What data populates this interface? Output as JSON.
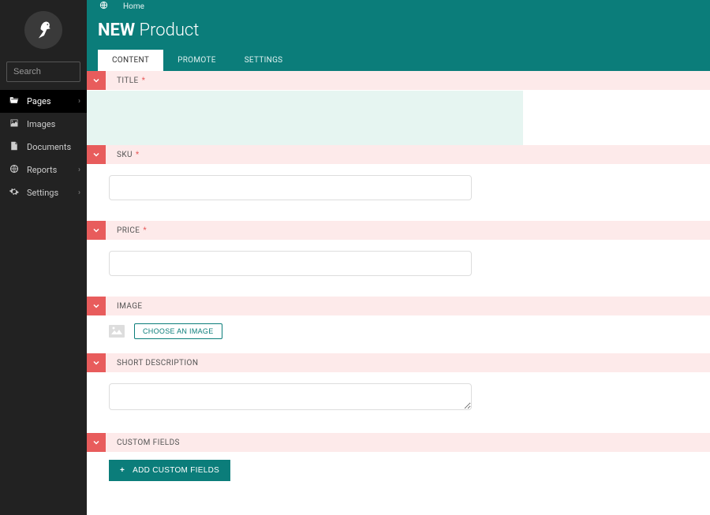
{
  "sidebar": {
    "search_placeholder": "Search",
    "items": [
      {
        "icon": "folder",
        "label": "Pages",
        "chevron": true,
        "active": true
      },
      {
        "icon": "image",
        "label": "Images",
        "chevron": false,
        "active": false
      },
      {
        "icon": "doc",
        "label": "Documents",
        "chevron": false,
        "active": false
      },
      {
        "icon": "globe",
        "label": "Reports",
        "chevron": true,
        "active": false
      },
      {
        "icon": "cog",
        "label": "Settings",
        "chevron": true,
        "active": false
      }
    ]
  },
  "breadcrumb": {
    "home": "Home"
  },
  "header": {
    "new": "NEW",
    "type": "Product"
  },
  "tabs": [
    {
      "label": "CONTENT",
      "active": true
    },
    {
      "label": "PROMOTE",
      "active": false
    },
    {
      "label": "SETTINGS",
      "active": false
    }
  ],
  "fields": {
    "title": {
      "label": "TITLE",
      "required": true,
      "value": ""
    },
    "sku": {
      "label": "SKU",
      "required": true,
      "value": ""
    },
    "price": {
      "label": "PRICE",
      "required": true,
      "value": ""
    },
    "image": {
      "label": "IMAGE",
      "required": false,
      "choose_label": "CHOOSE AN IMAGE"
    },
    "short_desc": {
      "label": "SHORT DESCRIPTION",
      "required": false,
      "value": ""
    },
    "custom": {
      "label": "CUSTOM FIELDS",
      "add_label": "ADD CUSTOM FIELDS"
    }
  }
}
